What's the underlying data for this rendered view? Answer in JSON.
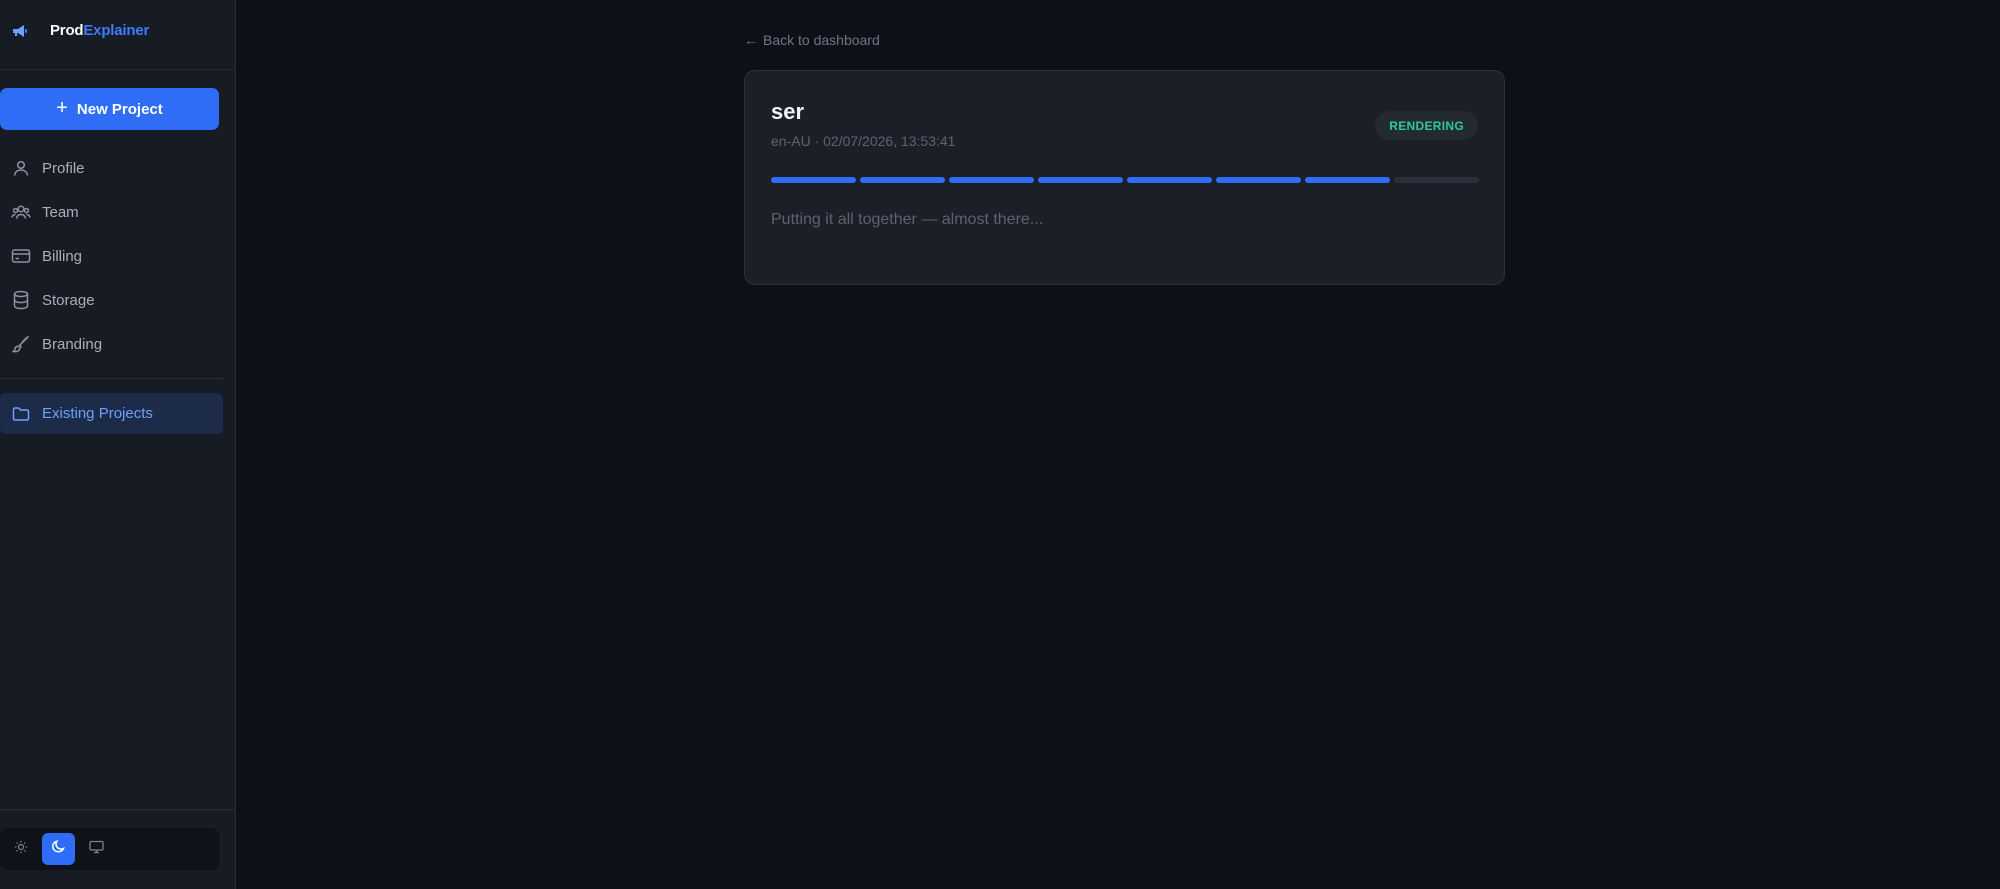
{
  "brand": {
    "part1": "Prod",
    "part2": "Explainer",
    "logo_icon": "megaphone-icon",
    "accent": "#3d7bff"
  },
  "sidebar": {
    "new_project_label": "New Project",
    "items": [
      {
        "label": "Profile",
        "icon": "user-icon"
      },
      {
        "label": "Team",
        "icon": "users-icon"
      },
      {
        "label": "Billing",
        "icon": "credit-card-icon"
      },
      {
        "label": "Storage",
        "icon": "database-icon"
      },
      {
        "label": "Branding",
        "icon": "brush-icon"
      }
    ],
    "active_item": {
      "label": "Existing Projects",
      "icon": "folder-icon"
    },
    "theme": {
      "options": [
        "light",
        "dark",
        "system"
      ],
      "selected": "dark"
    }
  },
  "main": {
    "back_label": "Back to dashboard",
    "project": {
      "title": "ser",
      "meta": "en-AU · 02/07/2026, 13:53:41",
      "status": "RENDERING",
      "status_color": "#2fc7a3",
      "progress_steps_total": 8,
      "progress_steps_done": 7,
      "message": "Putting it all together — almost there..."
    }
  }
}
